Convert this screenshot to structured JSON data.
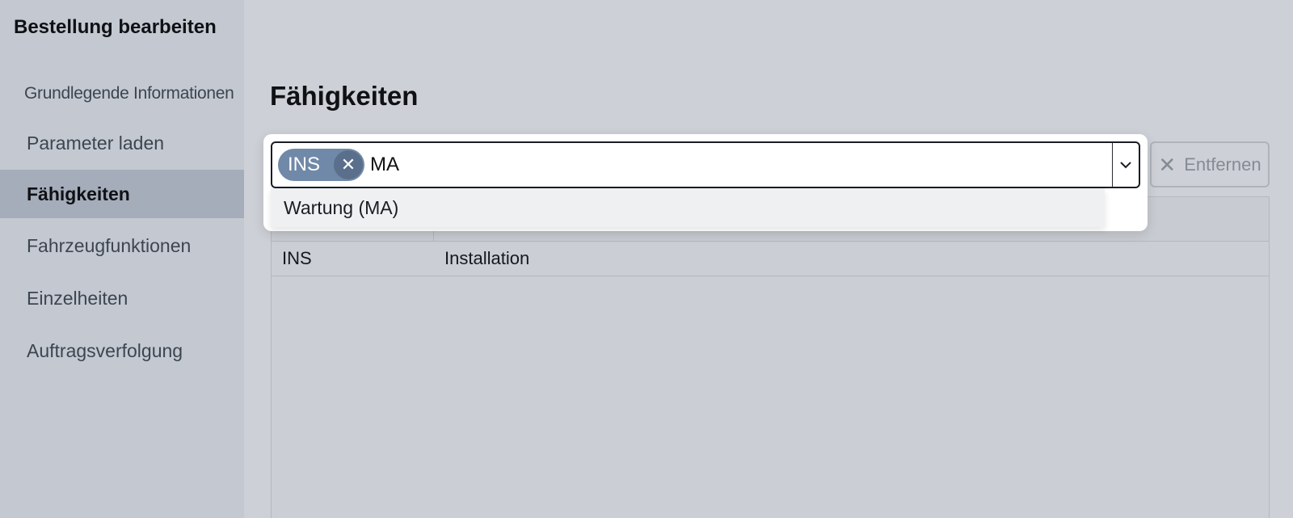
{
  "sidebar": {
    "title": "Bestellung bearbeiten",
    "items": [
      {
        "label": "Grundlegende Informationen",
        "active": false
      },
      {
        "label": "Parameter laden",
        "active": false
      },
      {
        "label": "Fähigkeiten",
        "active": true
      },
      {
        "label": "Fahrzeugfunktionen",
        "active": false
      },
      {
        "label": "Einzelheiten",
        "active": false
      },
      {
        "label": "Auftragsverfolgung",
        "active": false
      }
    ]
  },
  "main": {
    "title": "Fähigkeiten",
    "multiselect": {
      "chips": [
        {
          "label": "INS"
        }
      ],
      "input_value": "MA",
      "options": [
        {
          "label": "Wartung (MA)"
        }
      ]
    },
    "remove_button": {
      "label": "Entfernen"
    },
    "table": {
      "rows": [
        {
          "code": "INS",
          "name": "Installation"
        }
      ]
    }
  },
  "colors": {
    "sidebar_bg": "#c4c9d1",
    "sidebar_active": "#a5adba",
    "chip": "#7189a8",
    "main_bg": "#cdd0d6"
  }
}
